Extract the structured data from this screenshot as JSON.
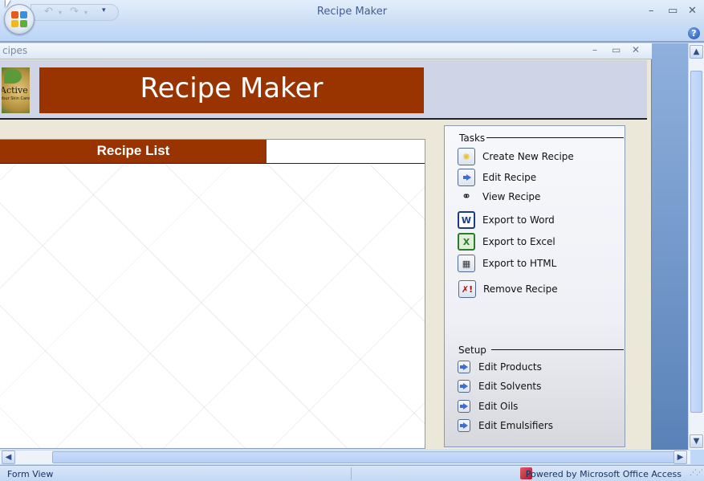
{
  "app": {
    "title": "Recipe Maker",
    "window_controls": {
      "minimize": "–",
      "maximize": "▭",
      "close": "✕"
    },
    "qat": {
      "undo": "↶",
      "redo": "↷",
      "customize": "▾"
    },
    "help": "?"
  },
  "document": {
    "title": "cipes",
    "controls": {
      "minimize": "–",
      "maximize": "▭",
      "close": "✕"
    }
  },
  "header": {
    "logo_text": "Active",
    "logo_sub": "Your Skin Care",
    "banner": "Recipe Maker"
  },
  "recipe_list": {
    "header": "Recipe List"
  },
  "tasks": {
    "label": "Tasks",
    "items": [
      {
        "label": "Create New Recipe",
        "icon": "new-icon"
      },
      {
        "label": "Edit Recipe",
        "icon": "arrow-right-icon"
      },
      {
        "label": "View Recipe",
        "icon": "binoculars-icon"
      },
      {
        "label": "Export to Word",
        "icon": "word-icon"
      },
      {
        "label": "Export to Excel",
        "icon": "excel-icon"
      },
      {
        "label": "Export to HTML",
        "icon": "html-icon"
      },
      {
        "label": "Remove Recipe",
        "icon": "delete-icon"
      }
    ]
  },
  "setup": {
    "label": "Setup",
    "items": [
      {
        "label": "Edit Products"
      },
      {
        "label": "Edit Solvents"
      },
      {
        "label": "Edit Oils"
      },
      {
        "label": "Edit Emulsifiers"
      }
    ]
  },
  "scrollbars": {
    "up": "▲",
    "down": "▼",
    "left": "◀",
    "right": "▶"
  },
  "statusbar": {
    "view": "Form View",
    "powered_by": "Powered by Microsoft Office Access"
  }
}
